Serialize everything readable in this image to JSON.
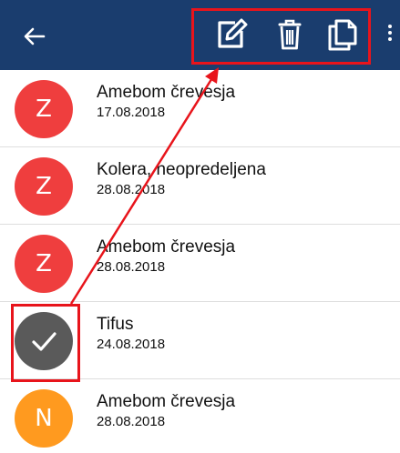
{
  "appbar": {
    "background": "#1a3d6e",
    "back_icon": "arrow-left-icon",
    "actions": [
      {
        "icon": "edit-icon"
      },
      {
        "icon": "trash-icon"
      },
      {
        "icon": "copy-icon"
      }
    ],
    "overflow_icon": "more-vertical-icon"
  },
  "list": {
    "items": [
      {
        "initial": "Z",
        "title": "Amebom črevesja",
        "date": "17.08.2018",
        "color": "#ef3e3e",
        "selected": false
      },
      {
        "initial": "Z",
        "title": "Kolera, neopredeljena",
        "date": "28.08.2018",
        "color": "#ef3e3e",
        "selected": false
      },
      {
        "initial": "Z",
        "title": "Amebom črevesja",
        "date": "28.08.2018",
        "color": "#ef3e3e",
        "selected": false
      },
      {
        "initial": "",
        "title": "Tifus",
        "date": "24.08.2018",
        "color": "#5a5a5a",
        "selected": true
      },
      {
        "initial": "N",
        "title": "Amebom črevesja",
        "date": "28.08.2018",
        "color": "#ff9a1f",
        "selected": false
      }
    ]
  },
  "annotation": {
    "color": "#e8141b"
  }
}
